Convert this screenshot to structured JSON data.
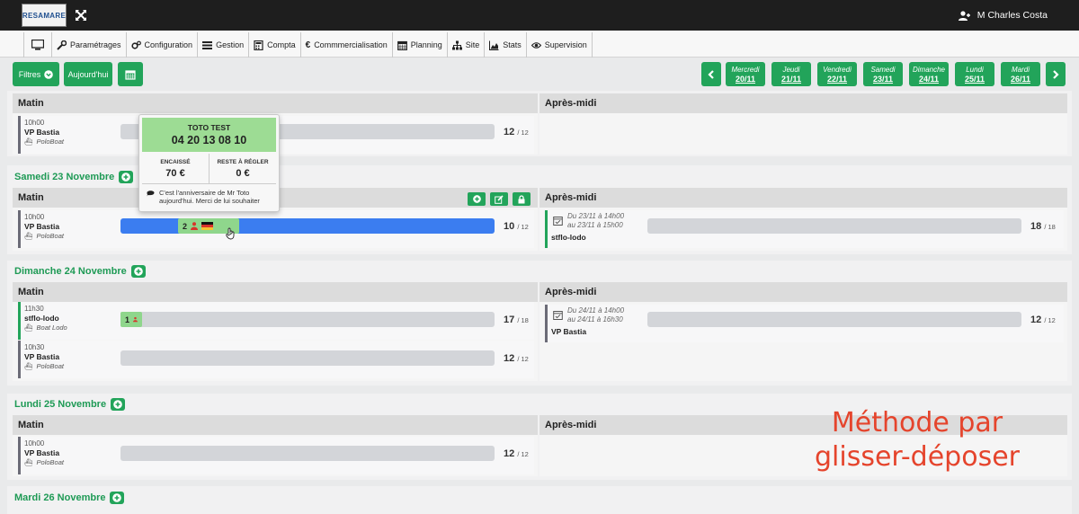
{
  "header": {
    "logo_text": "RESAMARE",
    "user_name": "M Charles Costa"
  },
  "nav": {
    "items": [
      {
        "label": "Paramétrages",
        "icon": "wrench-icon"
      },
      {
        "label": "Configuration",
        "icon": "gears-icon"
      },
      {
        "label": "Gestion",
        "icon": "list-icon"
      },
      {
        "label": "Compta",
        "icon": "calculator-icon"
      },
      {
        "label": "Commmercialisation",
        "icon": "euro-icon"
      },
      {
        "label": "Planning",
        "icon": "calendar-icon"
      },
      {
        "label": "Site",
        "icon": "sitemap-icon"
      },
      {
        "label": "Stats",
        "icon": "area-chart-icon"
      },
      {
        "label": "Supervision",
        "icon": "eye-icon"
      }
    ]
  },
  "toolbar": {
    "filters_label": "Filtres",
    "today_label": "Aujourd'hui",
    "days": [
      {
        "name": "Mercredi",
        "date": "20/11"
      },
      {
        "name": "Jeudi",
        "date": "21/11"
      },
      {
        "name": "Vendredi",
        "date": "22/11"
      },
      {
        "name": "Samedi",
        "date": "23/11"
      },
      {
        "name": "Dimanche",
        "date": "24/11"
      },
      {
        "name": "Lundi",
        "date": "25/11"
      },
      {
        "name": "Mardi",
        "date": "26/11"
      }
    ]
  },
  "labels": {
    "morning": "Matin",
    "afternoon": "Après-midi"
  },
  "day0": {
    "morning": {
      "time": "10h00",
      "boat": "VP Bastia",
      "company": "PoloBoat",
      "booked": "12",
      "capacity": "/ 12"
    }
  },
  "day1": {
    "title": "Samedi 23 Novembre",
    "morning": {
      "time": "10h00",
      "boat": "VP Bastia",
      "company": "PoloBoat",
      "booked": "10",
      "capacity": "/ 12",
      "chip_count": "2"
    },
    "afternoon": {
      "dates_line1": "Du 23/11 à 14h00",
      "dates_line2": "au 23/11 à 15h00",
      "boat": "stflo-lodo",
      "booked": "18",
      "capacity": "/ 18"
    }
  },
  "day2": {
    "title": "Dimanche 24 Novembre",
    "morning1": {
      "time": "11h30",
      "boat": "stflo-lodo",
      "company": "Boat Lodo",
      "booked": "17",
      "capacity": "/ 18",
      "chip_count": "1"
    },
    "morning2": {
      "time": "10h30",
      "boat": "VP Bastia",
      "company": "PoloBoat",
      "booked": "12",
      "capacity": "/ 12"
    },
    "afternoon": {
      "dates_line1": "Du 24/11 à 14h00",
      "dates_line2": "au 24/11 à 16h30",
      "boat": "VP Bastia",
      "booked": "12",
      "capacity": "/ 12"
    }
  },
  "day3": {
    "title": "Lundi 25 Novembre",
    "morning": {
      "time": "10h00",
      "boat": "VP Bastia",
      "company": "PoloBoat",
      "booked": "12",
      "capacity": "/ 12"
    }
  },
  "day4": {
    "title": "Mardi 26 Novembre"
  },
  "popover": {
    "name": "TOTO TEST",
    "phone": "04 20 13 08 10",
    "paid_label": "ENCAISSÉ",
    "paid_value": "70 €",
    "remaining_label": "RESTE À RÉGLER",
    "remaining_value": "0 €",
    "note": "C'est l'anniversaire de Mr Toto aujourd'hui. Merci de lui souhaiter"
  },
  "overlay": {
    "line1": "Méthode par",
    "line2": "glisser-déposer"
  },
  "colors": {
    "accent_green": "#22a45a",
    "bar_blue": "#3b7df0",
    "overlay_red": "#e5442c",
    "chip_green": "#8fd68c"
  }
}
